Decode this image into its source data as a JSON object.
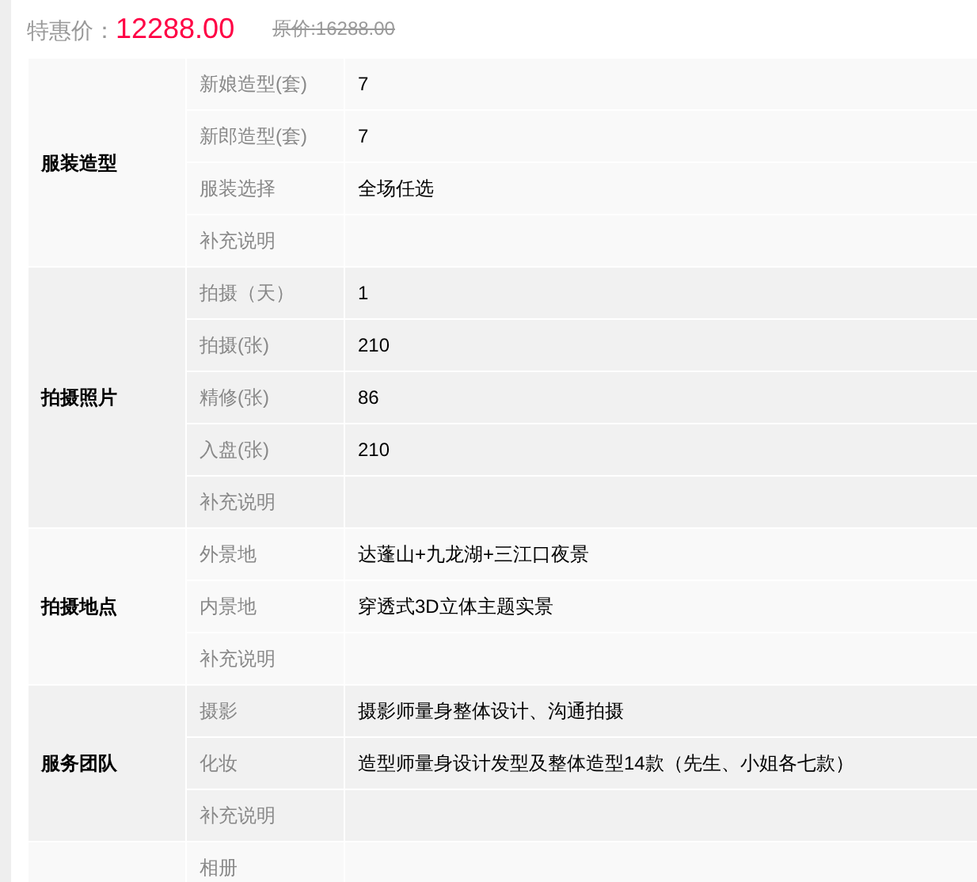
{
  "price": {
    "label": "特惠价：",
    "value": "12288.00",
    "original_label": "原价:",
    "original_value": "16288.00"
  },
  "groups": [
    {
      "category": "服装造型",
      "rows": [
        {
          "label": "新娘造型(套)",
          "value": "7"
        },
        {
          "label": "新郎造型(套)",
          "value": "7"
        },
        {
          "label": "服装选择",
          "value": "全场任选"
        },
        {
          "label": "补充说明"
        }
      ]
    },
    {
      "category": "拍摄照片",
      "rows": [
        {
          "label": "拍摄（天）",
          "value": "1"
        },
        {
          "label": "拍摄(张)",
          "value": "210"
        },
        {
          "label": "精修(张)",
          "value": "86"
        },
        {
          "label": "入盘(张)",
          "value": "210"
        },
        {
          "label": "补充说明"
        }
      ]
    },
    {
      "category": "拍摄地点",
      "rows": [
        {
          "label": "外景地",
          "value": "达蓬山+九龙湖+三江口夜景"
        },
        {
          "label": "内景地",
          "value": "穿透式3D立体主题实景"
        },
        {
          "label": "补充说明"
        }
      ]
    },
    {
      "category": "服务团队",
      "rows": [
        {
          "label": "摄影",
          "value": "摄影师量身整体设计、沟通拍摄"
        },
        {
          "label": "化妆",
          "value": "造型师量身设计发型及整体造型14款（先生、小姐各七款）"
        },
        {
          "label": "补充说明"
        }
      ]
    },
    {
      "rows": [
        {
          "label": "相册"
        }
      ]
    }
  ]
}
